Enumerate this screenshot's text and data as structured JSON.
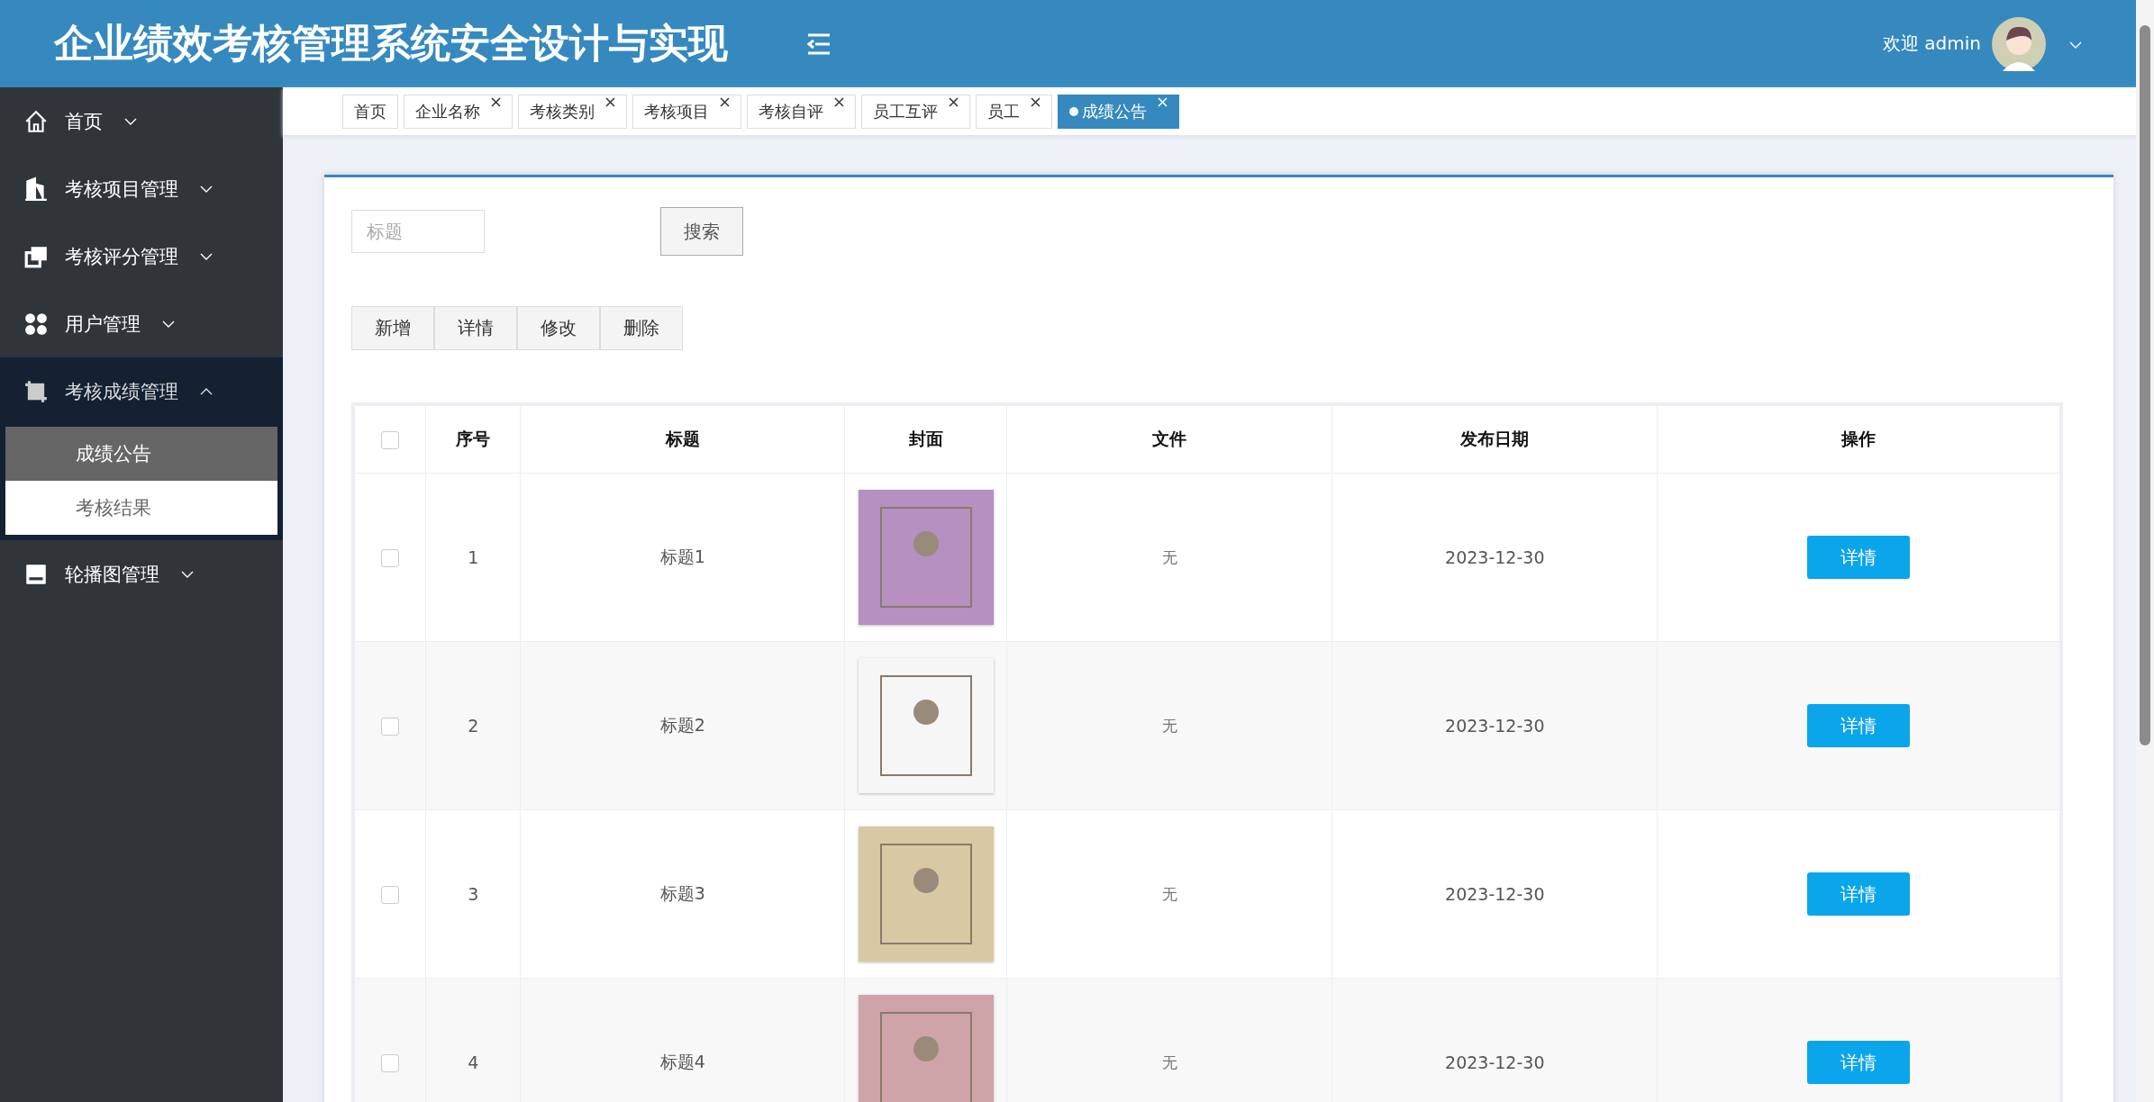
{
  "header": {
    "title": "企业绩效考核管理系统安全设计与实现",
    "welcome": "欢迎 admin"
  },
  "sidebar": {
    "items": [
      {
        "label": "首页",
        "expanded": false
      },
      {
        "label": "考核项目管理",
        "expanded": false
      },
      {
        "label": "考核评分管理",
        "expanded": false
      },
      {
        "label": "用户管理",
        "expanded": false
      },
      {
        "label": "考核成绩管理",
        "expanded": true,
        "children": [
          {
            "label": "成绩公告",
            "selected": true
          },
          {
            "label": "考核结果",
            "selected": false
          }
        ]
      },
      {
        "label": "轮播图管理",
        "expanded": false
      }
    ]
  },
  "tabs": [
    {
      "label": "首页",
      "closable": false,
      "selected": false
    },
    {
      "label": "企业名称",
      "closable": true,
      "selected": false
    },
    {
      "label": "考核类别",
      "closable": true,
      "selected": false
    },
    {
      "label": "考核项目",
      "closable": true,
      "selected": false
    },
    {
      "label": "考核自评",
      "closable": true,
      "selected": false
    },
    {
      "label": "员工互评",
      "closable": true,
      "selected": false
    },
    {
      "label": "员工",
      "closable": true,
      "selected": false
    },
    {
      "label": "成绩公告",
      "closable": true,
      "selected": true
    }
  ],
  "search": {
    "placeholder": "标题",
    "button": "搜索"
  },
  "actions": [
    "新增",
    "详情",
    "修改",
    "删除"
  ],
  "table": {
    "columns": [
      "序号",
      "标题",
      "封面",
      "文件",
      "发布日期",
      "操作"
    ],
    "header_checked": false,
    "rows": [
      {
        "index": "1",
        "title": "标题1",
        "file": "无",
        "date": "2023-12-30",
        "action": "详情",
        "checked": false
      },
      {
        "index": "2",
        "title": "标题2",
        "file": "无",
        "date": "2023-12-30",
        "action": "详情",
        "checked": false
      },
      {
        "index": "3",
        "title": "标题3",
        "file": "无",
        "date": "2023-12-30",
        "action": "详情",
        "checked": false
      },
      {
        "index": "4",
        "title": "标题4",
        "file": "无",
        "date": "2023-12-30",
        "action": "详情",
        "checked": false
      }
    ]
  }
}
